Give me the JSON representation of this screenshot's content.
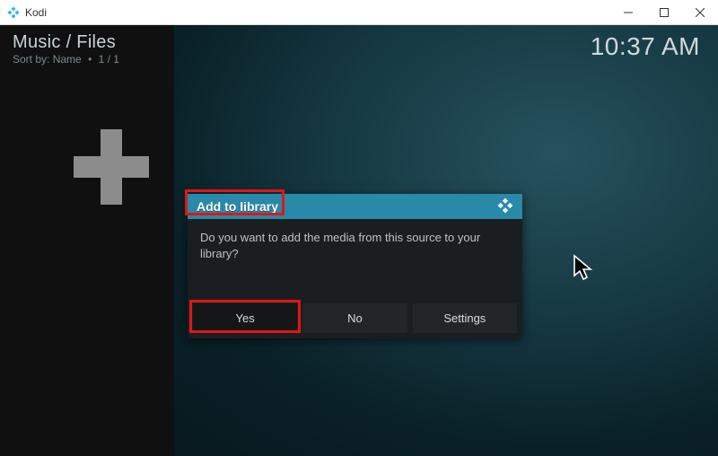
{
  "window": {
    "title": "Kodi"
  },
  "breadcrumb": {
    "path": "Music / Files",
    "sort_label": "Sort by:",
    "sort_value": "Name",
    "pagination": "1 / 1"
  },
  "clock": "10:37 AM",
  "dialog": {
    "title": "Add to library",
    "message": "Do you want to add the media from this source to your library?",
    "buttons": {
      "yes": "Yes",
      "no": "No",
      "settings": "Settings"
    }
  }
}
